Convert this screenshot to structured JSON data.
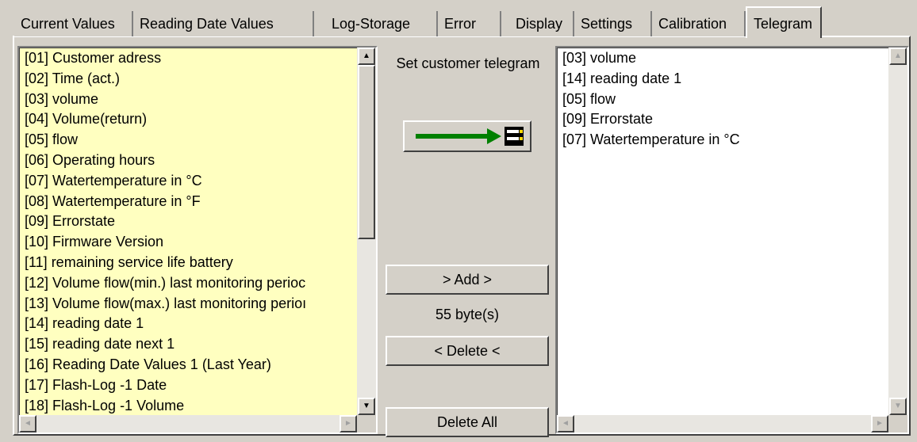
{
  "tabs": [
    {
      "label": "Current Values"
    },
    {
      "label": "Reading Date Values"
    },
    {
      "label": "Log-Storage"
    },
    {
      "label": "Error"
    },
    {
      "label": "Display"
    },
    {
      "label": "Settings"
    },
    {
      "label": "Calibration"
    },
    {
      "label": "Telegram"
    }
  ],
  "active_tab": "Telegram",
  "available_list": {
    "background": "#ffffc0",
    "items": [
      "[01] Customer adress",
      "[02] Time (act.)",
      "[03] volume",
      "[04] Volume(return)",
      "[05] flow",
      "[06] Operating hours",
      "[07] Watertemperature in °C",
      "[08] Watertemperature in °F",
      "[09] Errorstate",
      "[10] Firmware Version",
      "[11] remaining service life battery",
      "[12] Volume flow(min.) last monitoring perioc",
      "[13] Volume flow(max.) last monitoring perioı",
      "[14] reading date 1",
      "[15] reading date next 1",
      "[16] Reading Date Values 1 (Last Year)",
      "[17] Flash-Log -1 Date",
      "[18] Flash-Log -1 Volume"
    ]
  },
  "set_label": "Set customer telegram",
  "set_button_icon": "arrow-right-to-list-icon",
  "add_label": "> Add >",
  "byte_count": "55  byte(s)",
  "delete_label": "< Delete <",
  "delete_all_label": "Delete All",
  "telegram_list": {
    "background": "#ffffff",
    "items": [
      "[03] volume",
      "[14] reading date 1",
      "[05] flow",
      "[09] Errorstate",
      "[07] Watertemperature in °C"
    ]
  }
}
